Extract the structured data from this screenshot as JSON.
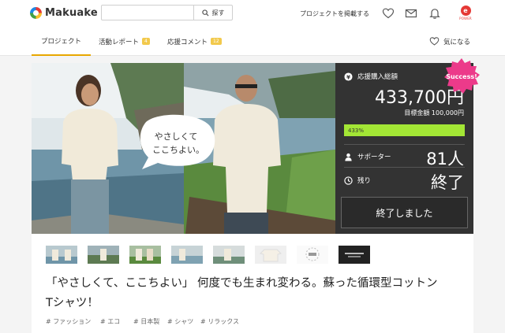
{
  "header": {
    "logo_text": "Makuake",
    "search_placeholder": "",
    "search_button_label": "探す",
    "post_project_label": "プロジェクトを掲載する",
    "brand_badge_text": "POWER"
  },
  "tabs": [
    {
      "label": "プロジェクト",
      "count": ""
    },
    {
      "label": "活動レポート",
      "count": "4"
    },
    {
      "label": "応援コメント",
      "count": "12"
    }
  ],
  "favorite_label": "気になる",
  "hero": {
    "speech_text_line1": "やさしくて",
    "speech_text_line2": "ここちよい。"
  },
  "stats": {
    "total_label": "応援購入総額",
    "total_amount": "433,700円",
    "goal_text": "目標金額 100,000円",
    "progress_text": "433%",
    "progress_percent": 433,
    "supporters_label": "サポーター",
    "supporters_value": "81人",
    "remaining_label": "残り",
    "remaining_value": "終了",
    "ended_button_label": "終了しました",
    "success_badge": "Success!"
  },
  "project": {
    "title_line1": "「やさしくて、ここちよい」 何度でも生まれ変わる。蘇った循環型コットン",
    "title_line2": "Tシャツ！",
    "tags": [
      "# ファッション",
      "# エコ",
      "# 日本製",
      "# シャツ",
      "# リラックス"
    ]
  },
  "colors": {
    "accent": "#e8a700",
    "progress": "#a3e635",
    "success_badge": "#ec3a8a",
    "stats_bg": "#333333"
  }
}
